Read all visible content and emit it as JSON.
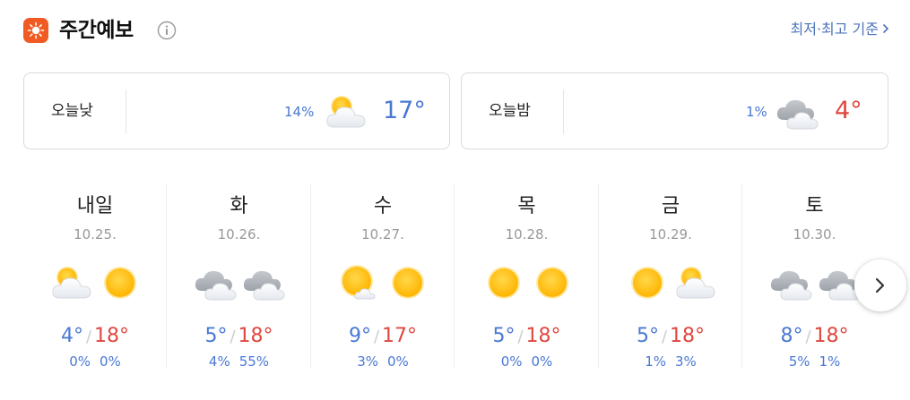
{
  "header": {
    "title": "주간예보",
    "criteria_link": "최저·최고 기준",
    "app_icon": "sun-icon",
    "info_icon": "info-icon"
  },
  "today": {
    "day": {
      "label": "오늘낮",
      "pop": "14%",
      "icon": "partly-cloudy-icon",
      "temp": "17°",
      "temp_color": "#4a78d4"
    },
    "night": {
      "label": "오늘밤",
      "pop": "1%",
      "icon": "cloudy-icon",
      "temp": "4°",
      "temp_color": "#e0473f"
    }
  },
  "week": [
    {
      "name": "내일",
      "date": "10.25.",
      "am_icon": "partly-cloudy-icon",
      "pm_icon": "sun-icon",
      "low": "4°",
      "high": "18°",
      "am_pop": "0%",
      "pm_pop": "0%"
    },
    {
      "name": "화",
      "date": "10.26.",
      "am_icon": "cloudy-icon",
      "pm_icon": "cloudy-icon",
      "low": "5°",
      "high": "18°",
      "am_pop": "4%",
      "pm_pop": "55%"
    },
    {
      "name": "수",
      "date": "10.27.",
      "am_icon": "mostly-sunny-icon",
      "pm_icon": "sun-icon",
      "low": "9°",
      "high": "17°",
      "am_pop": "3%",
      "pm_pop": "0%"
    },
    {
      "name": "목",
      "date": "10.28.",
      "am_icon": "sun-icon",
      "pm_icon": "sun-icon",
      "low": "5°",
      "high": "18°",
      "am_pop": "0%",
      "pm_pop": "0%"
    },
    {
      "name": "금",
      "date": "10.29.",
      "am_icon": "sun-icon",
      "pm_icon": "partly-cloudy-icon",
      "low": "5°",
      "high": "18°",
      "am_pop": "1%",
      "pm_pop": "3%"
    },
    {
      "name": "토",
      "date": "10.30.",
      "am_icon": "cloudy-icon",
      "pm_icon": "cloudy-icon",
      "low": "8°",
      "high": "18°",
      "am_pop": "5%",
      "pm_pop": "1%"
    }
  ],
  "colors": {
    "low": "#4a78d4",
    "high": "#e0473f",
    "accent": "#f15a22",
    "link": "#4a73b8"
  },
  "next_button_icon": "chevron-right-icon"
}
